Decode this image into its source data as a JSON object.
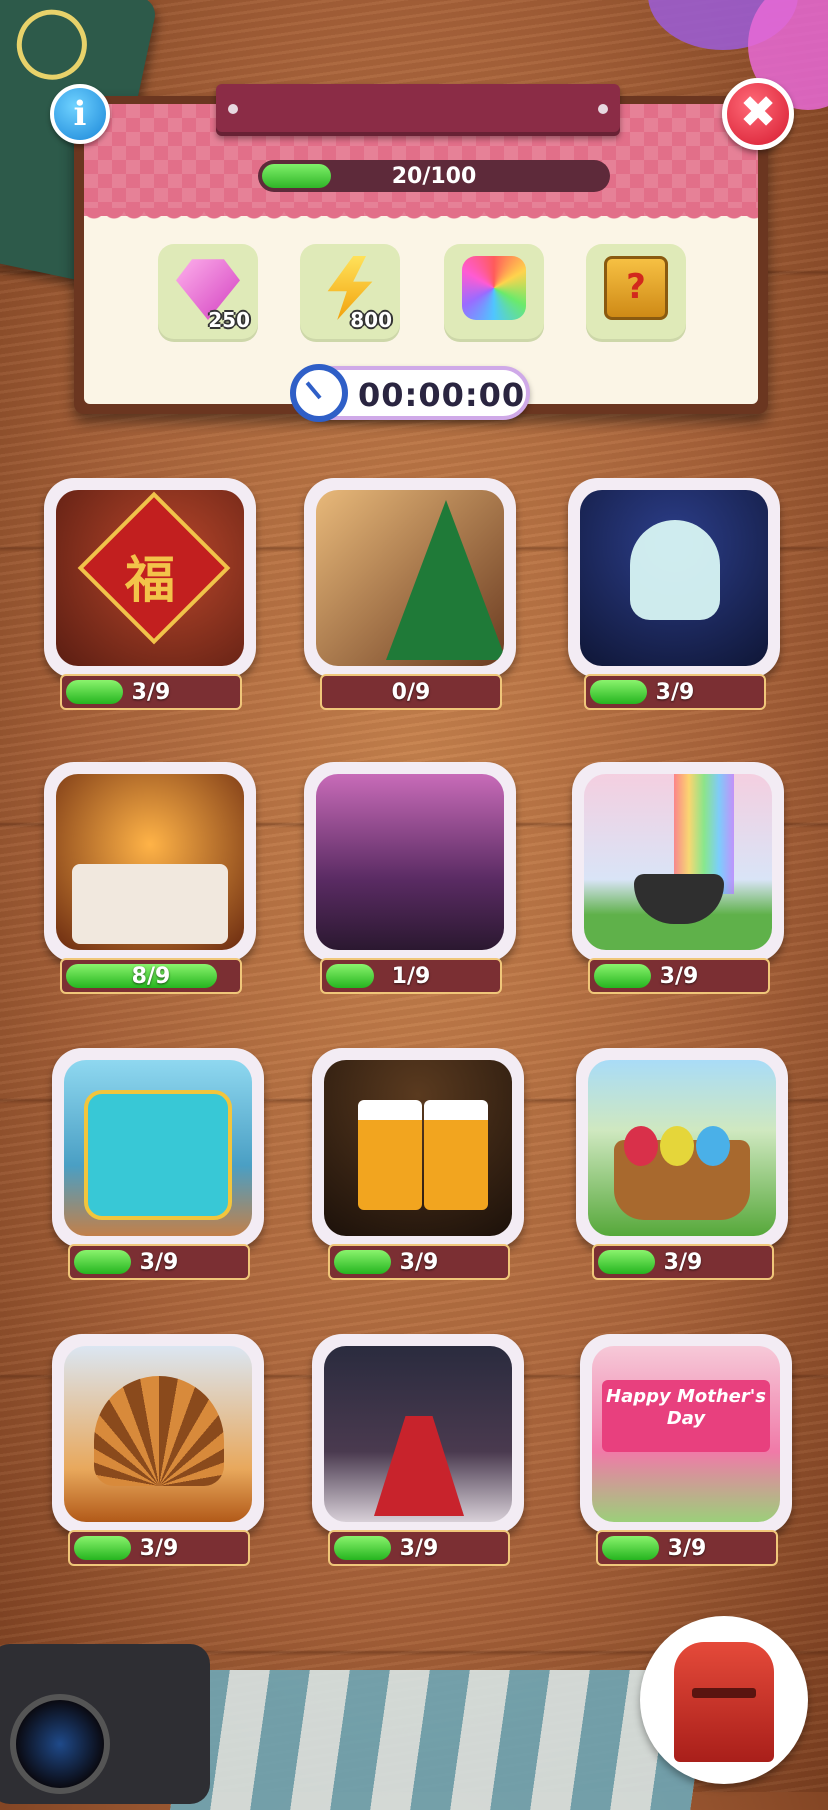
{
  "event": {
    "progress_text": "20/100",
    "progress_fraction": 0.2,
    "timer": "00:00:00",
    "rewards": [
      {
        "type": "gem",
        "icon": "pink-gem-icon",
        "amount": "250"
      },
      {
        "type": "energy",
        "icon": "lightning-bolt-icon",
        "amount": "800"
      },
      {
        "type": "puzzle",
        "icon": "rainbow-puzzle-piece-icon",
        "amount": ""
      },
      {
        "type": "mystery",
        "icon": "mystery-box-icon",
        "amount": "?"
      }
    ]
  },
  "buttons": {
    "info": "i",
    "close": "✖"
  },
  "levels": [
    {
      "theme": "lunar-new-year-fu-sign",
      "art_text": "福",
      "progress": "3/9",
      "fraction": 0.333
    },
    {
      "theme": "christmas-tree",
      "progress": "0/9",
      "fraction": 0
    },
    {
      "theme": "halloween-ghost",
      "progress": "3/9",
      "fraction": 0.333
    },
    {
      "theme": "day-of-the-dead-altar",
      "progress": "8/9",
      "fraction": 0.889
    },
    {
      "theme": "cherry-blossom-festival",
      "progress": "1/9",
      "fraction": 0.111
    },
    {
      "theme": "st-patricks-pot-of-gold",
      "progress": "3/9",
      "fraction": 0.333
    },
    {
      "theme": "decorated-tuk-tuk",
      "progress": "3/9",
      "fraction": 0.333
    },
    {
      "theme": "oktoberfest-beer",
      "progress": "3/9",
      "fraction": 0.333
    },
    {
      "theme": "easter-egg-basket",
      "progress": "3/9",
      "fraction": 0.333
    },
    {
      "theme": "thanksgiving-turkey",
      "progress": "3/9",
      "fraction": 0.333
    },
    {
      "theme": "folk-dancer",
      "progress": "3/9",
      "fraction": 0.333
    },
    {
      "theme": "mothers-day-banner",
      "art_text": "Happy Mother's Day",
      "progress": "3/9",
      "fraction": 0.333
    }
  ],
  "colors": {
    "accent_green": "#25b51f",
    "panel_pink": "#e26f89",
    "bar_red": "#7b2f33"
  }
}
